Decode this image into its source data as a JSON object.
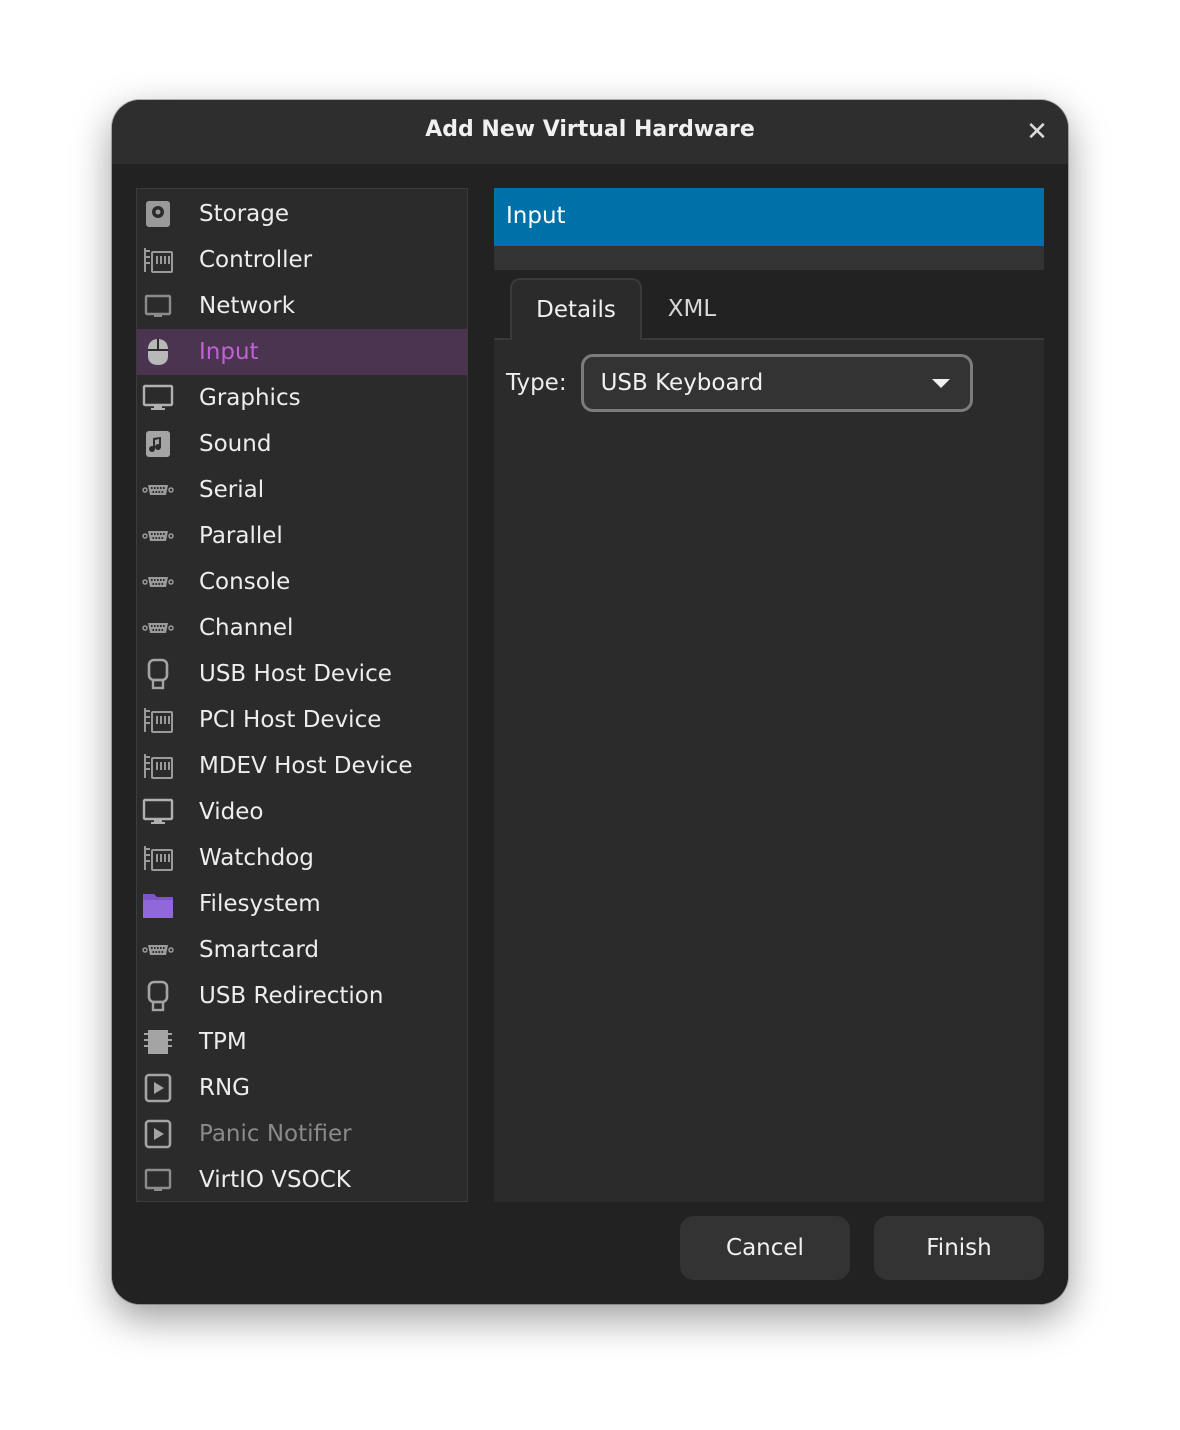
{
  "window": {
    "title": "Add New Virtual Hardware",
    "close_icon": "close-icon"
  },
  "hardware_list": {
    "selected": "Input",
    "items": [
      {
        "label": "Storage",
        "icon": "disk-icon"
      },
      {
        "label": "Controller",
        "icon": "card-icon"
      },
      {
        "label": "Network",
        "icon": "network-icon"
      },
      {
        "label": "Input",
        "icon": "mouse-icon"
      },
      {
        "label": "Graphics",
        "icon": "monitor-icon"
      },
      {
        "label": "Sound",
        "icon": "music-icon"
      },
      {
        "label": "Serial",
        "icon": "serial-port-icon"
      },
      {
        "label": "Parallel",
        "icon": "serial-port-icon"
      },
      {
        "label": "Console",
        "icon": "serial-port-icon"
      },
      {
        "label": "Channel",
        "icon": "serial-port-icon"
      },
      {
        "label": "USB Host Device",
        "icon": "usb-icon"
      },
      {
        "label": "PCI Host Device",
        "icon": "card-icon"
      },
      {
        "label": "MDEV Host Device",
        "icon": "card-icon"
      },
      {
        "label": "Video",
        "icon": "monitor-icon"
      },
      {
        "label": "Watchdog",
        "icon": "card-icon"
      },
      {
        "label": "Filesystem",
        "icon": "folder-icon"
      },
      {
        "label": "Smartcard",
        "icon": "serial-port-icon"
      },
      {
        "label": "USB Redirection",
        "icon": "usb-icon"
      },
      {
        "label": "TPM",
        "icon": "chip-icon"
      },
      {
        "label": "RNG",
        "icon": "play-icon"
      },
      {
        "label": "Panic Notifier",
        "icon": "play-icon",
        "disabled": true
      },
      {
        "label": "VirtIO VSOCK",
        "icon": "network-icon"
      }
    ]
  },
  "details_panel": {
    "header": "Input",
    "tabs": [
      {
        "label": "Details",
        "active": true
      },
      {
        "label": "XML",
        "active": false
      }
    ],
    "type": {
      "label": "Type:",
      "value": "USB Keyboard"
    }
  },
  "buttons": {
    "cancel": "Cancel",
    "finish": "Finish"
  },
  "colors": {
    "selection_bg": "#4a3450",
    "selection_text": "#c062d4",
    "header_accent": "#0070a8",
    "folder_purple": "#7d55c7"
  }
}
